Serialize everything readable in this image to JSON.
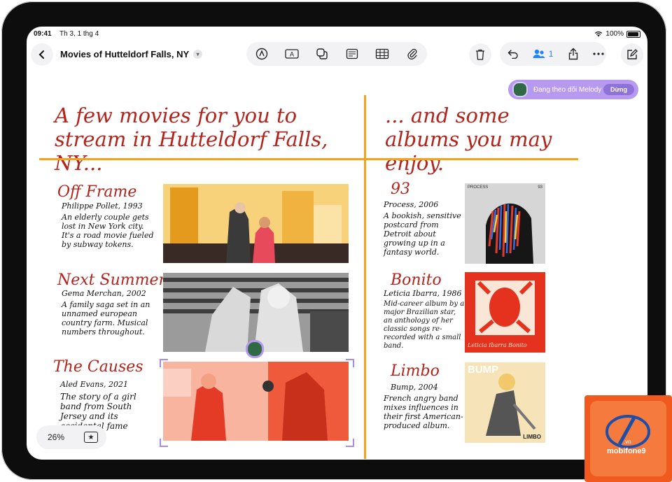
{
  "status": {
    "time": "09:41",
    "date": "Th 3, 1 thg 4",
    "battery": "100%"
  },
  "toolbar": {
    "title": "Movies of Hutteldorf Falls, NY",
    "collab_count": "1"
  },
  "follow": {
    "text": "Đang theo dõi Melody",
    "stop": "Dừng"
  },
  "board": {
    "heading_left": "A few movies for you to stream in Hutteldorf Falls, NY...",
    "heading_right": "... and some albums you may enjoy.",
    "movies": [
      {
        "title": "Off Frame",
        "meta": "Philippe Pollet, 1993",
        "desc": "An elderly couple gets lost in New York city. It's a road movie fueled by subway tokens."
      },
      {
        "title": "Next Summer",
        "meta": "Gema Merchan, 2002",
        "desc": "A family saga set in an unnamed european country farm. Musical numbers throughout."
      },
      {
        "title": "The Causes",
        "meta": "Aled Evans, 2021",
        "desc": "The story of a girl band from South Jersey and its accidental fame"
      }
    ],
    "albums": [
      {
        "title": "93",
        "meta": "Process, 2006",
        "desc": "A bookish, sensitive postcard from Detroit about growing up in a fantasy world.",
        "cover_label": "PROCESS",
        "cover_num": "93"
      },
      {
        "title": "Bonito",
        "meta": "Leticia Ibarra, 1986",
        "desc": "Mid-career album by a major Brazilian star, an anthology of her classic songs re-recorded with a small band.",
        "cover_label": "Leticia Ibarra Bonito"
      },
      {
        "title": "Limbo",
        "meta": "Bump, 2004",
        "desc": "French angry band mixes influences in their first American-produced album.",
        "cover_label": "BUMP",
        "cover_sub": "LIMBO"
      }
    ]
  },
  "zoom": {
    "level": "26%"
  },
  "watermark": {
    "brand": "mobifone9",
    "sub": ".vn"
  },
  "colors": {
    "accent_orange": "#f0a51c",
    "hand_red": "#b2241c",
    "follow_purple": "#b79af0"
  }
}
